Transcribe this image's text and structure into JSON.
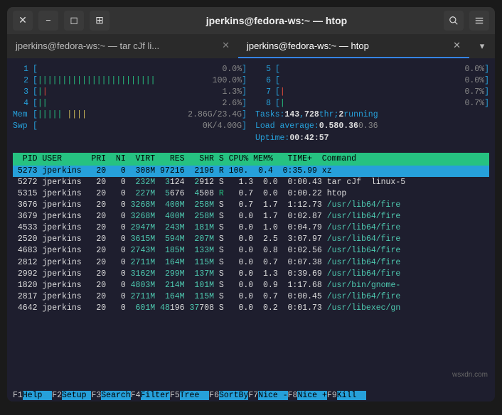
{
  "window": {
    "title": "jperkins@fedora-ws:~ — htop"
  },
  "tabs": [
    {
      "label": "jperkins@fedora-ws:~ — tar cJf li...",
      "active": false
    },
    {
      "label": "jperkins@fedora-ws:~ — htop",
      "active": true
    }
  ],
  "cpus": [
    {
      "n": "1",
      "bar": "",
      "val": "  0.0%"
    },
    {
      "n": "2",
      "bar": "||||||||||||||||||||||||",
      "val": "100.0%"
    },
    {
      "n": "3",
      "bar": "|",
      "val": "  1.3%"
    },
    {
      "n": "4",
      "bar": "||",
      "val": "  2.6%"
    },
    {
      "n": "5",
      "bar": "",
      "val": "  0.0%"
    },
    {
      "n": "6",
      "bar": "",
      "val": "  0.0%"
    },
    {
      "n": "7",
      "bar": "|",
      "val": "  0.7%"
    },
    {
      "n": "8",
      "bar": "|",
      "val": "  0.7%"
    }
  ],
  "mem": {
    "label": "Mem",
    "bar": "||||| ||||",
    "val": "2.86G/23.4G"
  },
  "swp": {
    "label": "Swp",
    "bar": "",
    "val": "0K/4.00G"
  },
  "tasks": {
    "label": "Tasks:",
    "procs": "143",
    "sep1": ",",
    "thr": "728",
    "thrlab": "thr;",
    "run": "2",
    "runlab": "running"
  },
  "loadavg": {
    "label": "Load average:",
    "v1": "0.58",
    "v2": "0.36",
    "v3": "0.36"
  },
  "uptime": {
    "label": "Uptime:",
    "val": "00:42:57"
  },
  "headerText": "  PID USER      PRI  NI  VIRT   RES   SHR S CPU% MEM%   TIME+  Command        ",
  "procs": [
    [
      " 5273 jperkins   20   0  308M 97216  2196 ",
      "R",
      " 100.  0.4  0:35.99 xz"
    ],
    [
      " 5272 jperkins   20   0  ",
      "232M",
      "  ",
      "3",
      "124  ",
      "2",
      "912 S   1.3  0.0  0:00.43 tar cJf  linux-5"
    ],
    [
      " 5315 jperkins   20   0  ",
      "227M",
      "  ",
      "5",
      "676  ",
      "4",
      "508 ",
      "R",
      "   0.7  0.0  0:00.22 htop"
    ],
    [
      " 3676 jperkins   20   0 ",
      "3268M",
      "  ",
      "400M",
      "  ",
      "258M",
      " S   0.7  1.7  1:12.73 ",
      "/usr/lib64/fire"
    ],
    [
      " 3679 jperkins   20   0 ",
      "3268M",
      "  ",
      "400M",
      "  ",
      "258M",
      " S   0.0  1.7  0:02.87 ",
      "/usr/lib64/fire"
    ],
    [
      " 4533 jperkins   20   0 ",
      "2947M",
      "  ",
      "243M",
      "  ",
      "181M",
      " S   0.0  1.0  0:04.79 ",
      "/usr/lib64/fire"
    ],
    [
      " 2520 jperkins   20   0 ",
      "3615M",
      "  ",
      "594M",
      "  ",
      "207M",
      " S   0.0  2.5  3:07.97 ",
      "/usr/lib64/fire"
    ],
    [
      " 4683 jperkins   20   0 ",
      "2743M",
      "  ",
      "185M",
      "  ",
      "133M",
      " S   0.0  0.8  0:02.56 ",
      "/usr/lib64/fire"
    ],
    [
      " 2812 jperkins   20   0 ",
      "2711M",
      "  ",
      "164M",
      "  ",
      "115M",
      " S   0.0  0.7  0:07.38 ",
      "/usr/lib64/fire"
    ],
    [
      " 2992 jperkins   20   0 ",
      "3162M",
      "  ",
      "299M",
      "  ",
      "137M",
      " S   0.0  1.3  0:39.69 ",
      "/usr/lib64/fire"
    ],
    [
      " 1820 jperkins   20   0 ",
      "4803M",
      "  ",
      "214M",
      "  ",
      "101M",
      " S   0.0  0.9  1:17.68 ",
      "/usr/bin/gnome-"
    ],
    [
      " 2817 jperkins   20   0 ",
      "2711M",
      "  ",
      "164M",
      "  ",
      "115M",
      " S   0.0  0.7  0:00.45 ",
      "/usr/lib64/fire"
    ],
    [
      " 4642 jperkins   20   0  ",
      "601M",
      " ",
      "48",
      "196 ",
      "37",
      "708 S   0.0  0.2  0:01.73 ",
      "/usr/libexec/gn"
    ]
  ],
  "fkeys": [
    {
      "k": "F1",
      "l": "Help  "
    },
    {
      "k": "F2",
      "l": "Setup "
    },
    {
      "k": "F3",
      "l": "Search"
    },
    {
      "k": "F4",
      "l": "Filter"
    },
    {
      "k": "F5",
      "l": "Tree  "
    },
    {
      "k": "F6",
      "l": "SortBy"
    },
    {
      "k": "F7",
      "l": "Nice -"
    },
    {
      "k": "F8",
      "l": "Nice +"
    },
    {
      "k": "F9",
      "l": "Kill  "
    }
  ],
  "watermark": "wsxdn.com"
}
